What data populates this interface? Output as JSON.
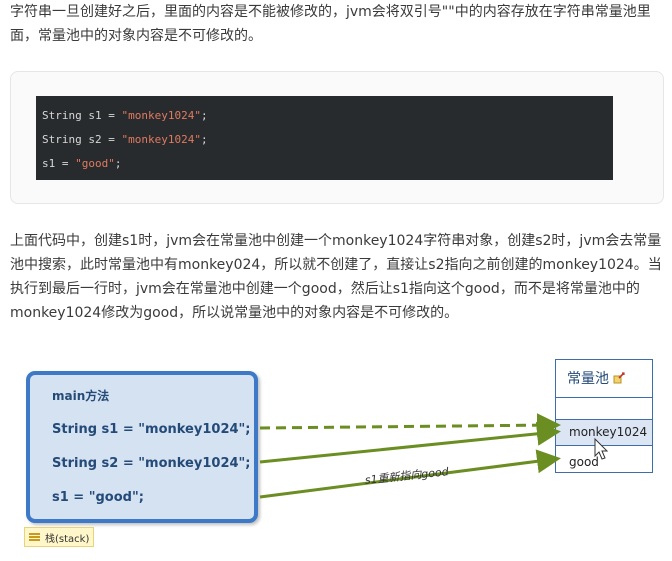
{
  "paragraphs": {
    "intro": "字符串一旦创建好之后，里面的内容是不能被修改的，jvm会将双引号\"\"中的内容存放在字符串常量池里面，常量池中的对象内容是不可修改的。",
    "explain": "上面代码中，创建s1时，jvm会在常量池中创建一个monkey1024字符串对象，创建s2时，jvm会去常量池中搜索，此时常量池中有monkey024，所以就不创建了，直接让s2指向之前创建的monkey1024。当执行到最后一行时，jvm会在常量池中创建一个good，然后让s1指向这个good，而不是将常量池中的monkey1024修改为good，所以说常量池中的对象内容是不可修改的。"
  },
  "code": {
    "lines": [
      {
        "code": "String s1 = ",
        "str": "\"monkey1024\"",
        "end": ";"
      },
      {
        "code": "String s2 = ",
        "str": "\"monkey1024\"",
        "end": ";"
      },
      {
        "code": "s1 = ",
        "str": "\"good\"",
        "end": ";"
      }
    ]
  },
  "diagram": {
    "stack": {
      "title": "main方法",
      "line1": "String s1 = \"monkey1024\";",
      "line2": "String s2 = \"monkey1024\";",
      "line3": "s1 = \"good\";",
      "tag": "栈(stack)"
    },
    "pool": {
      "title": "常量池",
      "items": [
        "monkey1024",
        "good"
      ]
    },
    "arrow_label": "s1重新指向good",
    "colors": {
      "stack_border": "#3d79c7",
      "stack_fill": "#d5e2f1",
      "arrow": "#6b8e23"
    }
  }
}
